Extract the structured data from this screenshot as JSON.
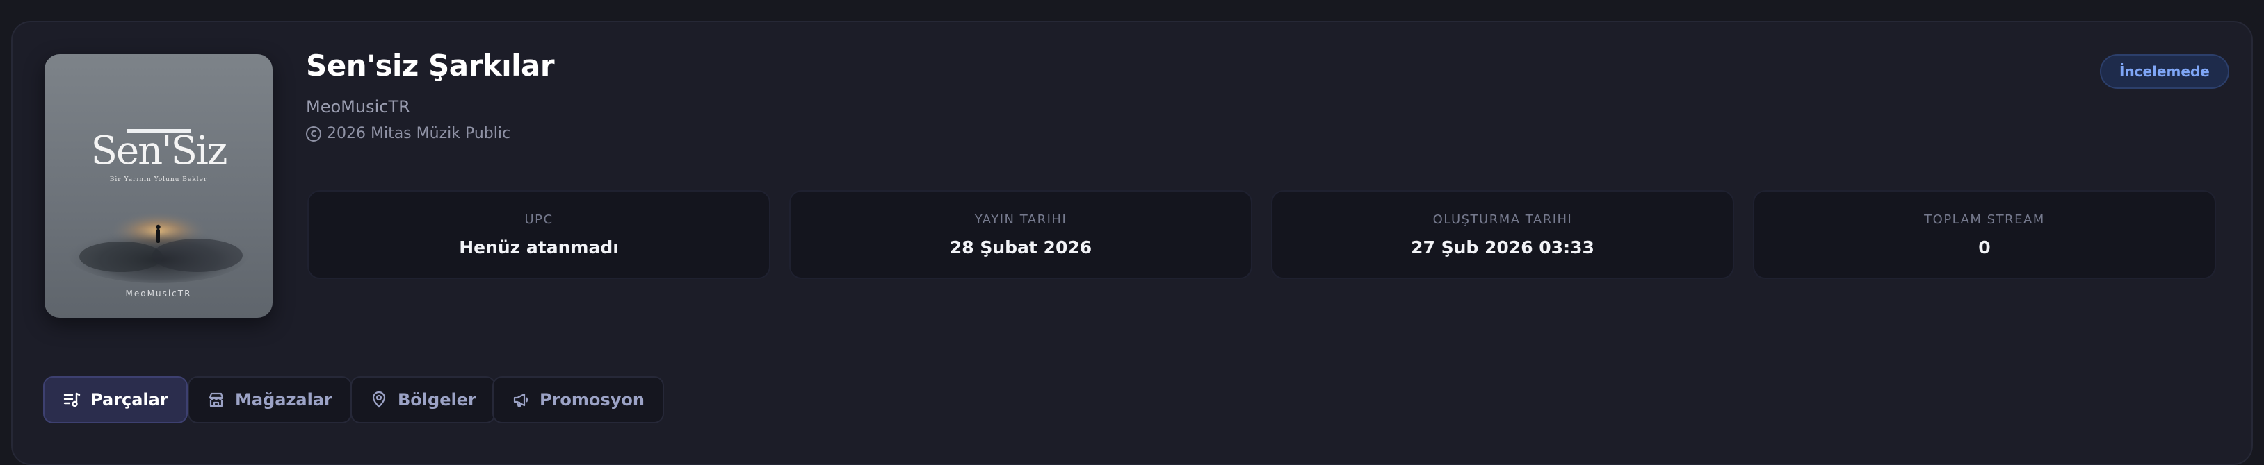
{
  "release": {
    "title": "Sen'siz Şarkılar",
    "artist": "MeoMusicTR",
    "copyright": "2026 Mitas Müzik Public",
    "copyright_symbol": "C",
    "status": "İncelemede"
  },
  "cover": {
    "title": "Sen'Siz",
    "subtitle": "Bir Yarının Yolunu Bekler",
    "artist": "MeoMusicTR"
  },
  "stats": [
    {
      "label": "UPC",
      "value": "Henüz atanmadı"
    },
    {
      "label": "YAYIN TARIHI",
      "value": "28 Şubat 2026"
    },
    {
      "label": "OLUŞTURMA TARIHI",
      "value": "27 Şub 2026 03:33"
    },
    {
      "label": "TOPLAM STREAM",
      "value": "0"
    }
  ],
  "tabs": [
    {
      "label": "Parçalar",
      "icon": "tracks-icon",
      "active": true
    },
    {
      "label": "Mağazalar",
      "icon": "store-icon",
      "active": false
    },
    {
      "label": "Bölgeler",
      "icon": "location-pin-icon",
      "active": false
    },
    {
      "label": "Promosyon",
      "icon": "megaphone-icon",
      "active": false
    }
  ],
  "colors": {
    "background": "#17181f",
    "panel": "#1c1d28",
    "status_badge_bg": "#1e2b4b",
    "status_badge_text": "#7fa6f6",
    "active_tab_bg": "#2b2d4d"
  }
}
